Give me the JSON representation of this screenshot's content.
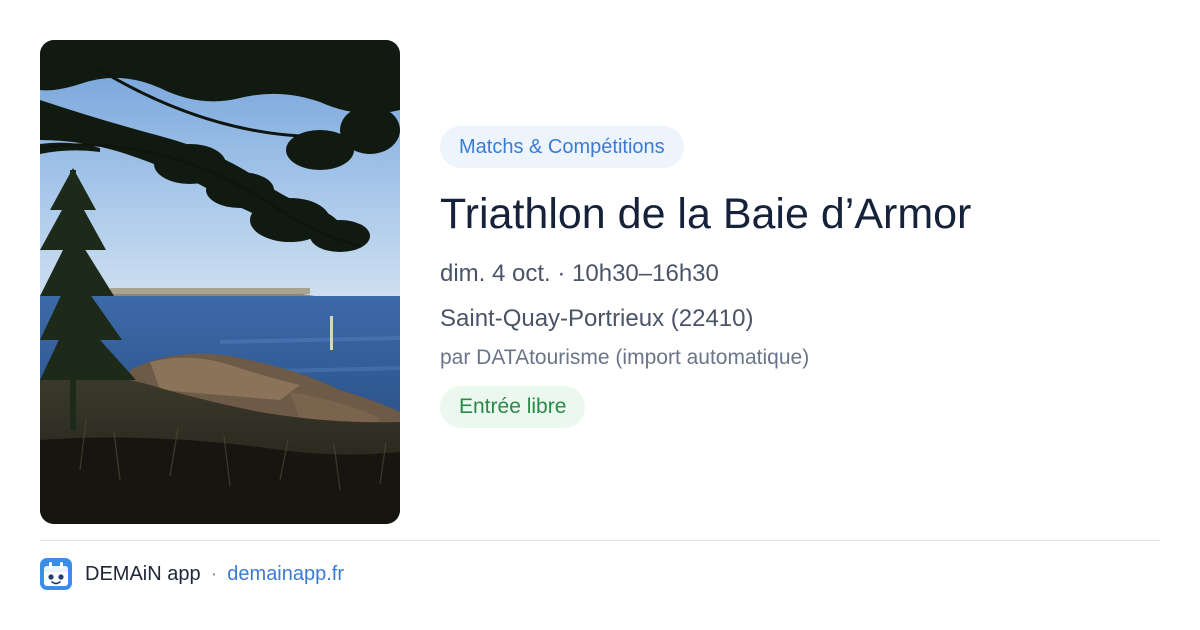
{
  "event": {
    "category": "Matchs & Compétitions",
    "title": "Triathlon de la Baie d’Armor",
    "when": "dim. 4 oct. · 10h30–16h30",
    "where": "Saint-Quay-Portrieux (22410)",
    "source": "par DATAtourisme (import automatique)",
    "price": "Entrée libre"
  },
  "footer": {
    "app_name": "DEMAiN app",
    "separator": "·",
    "site": "demainapp.fr"
  },
  "icons": {
    "app_logo": "demain-app-logo-icon"
  },
  "colors": {
    "category_text": "#3a7bd5",
    "category_bg": "#eef4fc",
    "price_text": "#2a8a47",
    "price_bg": "#ebf8ef",
    "title": "#16213a",
    "link": "#3a7bd5"
  }
}
